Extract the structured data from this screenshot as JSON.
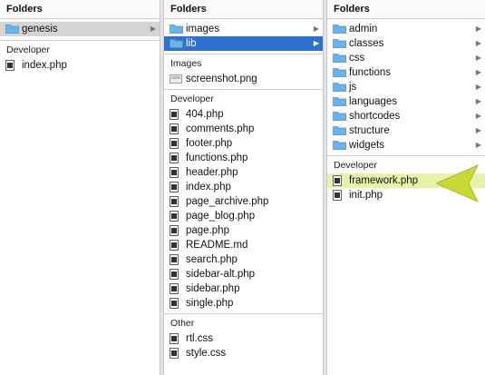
{
  "col1": {
    "header": "Folders",
    "folders": [
      {
        "label": "genesis",
        "selected": true
      }
    ],
    "developer_title": "Developer",
    "developer_files": [
      "index.php"
    ]
  },
  "col2": {
    "header": "Folders",
    "folders": [
      {
        "label": "images"
      },
      {
        "label": "lib",
        "selected": true
      }
    ],
    "images_title": "Images",
    "images_files": [
      "screenshot.png"
    ],
    "developer_title": "Developer",
    "developer_files": [
      "404.php",
      "comments.php",
      "footer.php",
      "functions.php",
      "header.php",
      "index.php",
      "page_archive.php",
      "page_blog.php",
      "page.php",
      "README.md",
      "search.php",
      "sidebar-alt.php",
      "sidebar.php",
      "single.php"
    ],
    "other_title": "Other",
    "other_files": [
      "rtl.css",
      "style.css"
    ]
  },
  "col3": {
    "header": "Folders",
    "folders": [
      "admin",
      "classes",
      "css",
      "functions",
      "js",
      "languages",
      "shortcodes",
      "structure",
      "widgets"
    ],
    "developer_title": "Developer",
    "developer_files": [
      {
        "label": "framework.php",
        "highlighted": true
      },
      {
        "label": "init.php"
      }
    ]
  },
  "colors": {
    "folder": "#6bb4e8",
    "selection_blue": "#2e6fd0",
    "selection_gray": "#d4d4d4",
    "highlight": "#e8f2a8",
    "arrow": "#c9d836"
  },
  "icons": {
    "folder": "folder-icon",
    "file": "php-file-icon",
    "image": "image-file-icon",
    "chevron": "chevron-right-icon",
    "pointer": "pointer-arrow-icon"
  }
}
